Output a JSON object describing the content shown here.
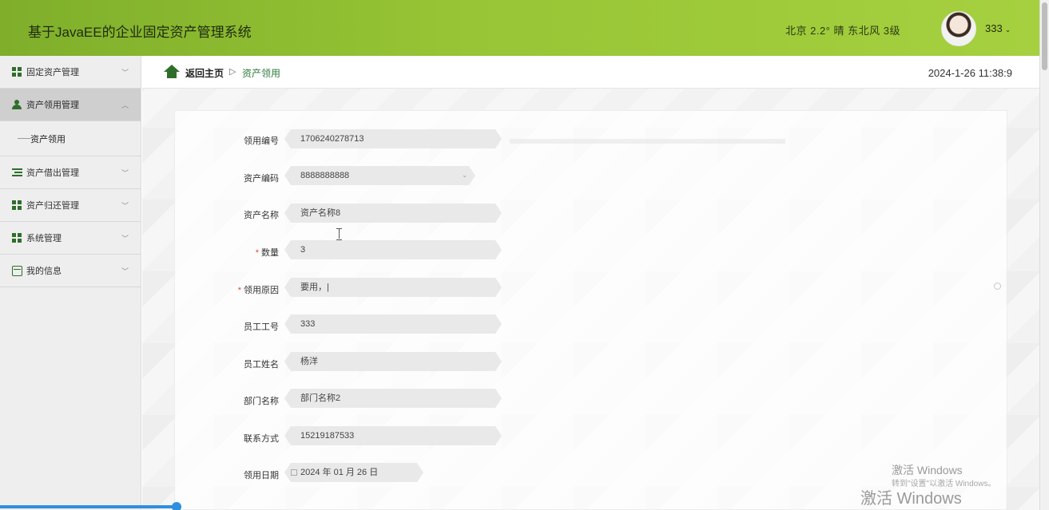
{
  "header": {
    "title": "基于JavaEE的企业固定资产管理系统",
    "weather": "北京  2.2°  晴  东北风  3级",
    "user": "333"
  },
  "sidebar": {
    "items": [
      {
        "label": "固定资产管理",
        "icon": "grid-icon"
      },
      {
        "label": "资产领用管理",
        "icon": "person-icon",
        "active": true
      },
      {
        "label": "资产借出管理",
        "icon": "list-icon"
      },
      {
        "label": "资产归还管理",
        "icon": "grid-icon"
      },
      {
        "label": "系统管理",
        "icon": "grid-icon"
      },
      {
        "label": "我的信息",
        "icon": "card-icon"
      }
    ],
    "sub_items": [
      {
        "label": "资产领用"
      }
    ]
  },
  "breadcrumb": {
    "home": "返回主页",
    "separator": "▷",
    "current": "资产领用"
  },
  "clock": "2024-1-26 11:38:9",
  "form": {
    "fields": [
      {
        "label": "领用编号",
        "value": "1706240278713",
        "required": false
      },
      {
        "label": "资产编码",
        "value": "8888888888",
        "required": false
      },
      {
        "label": "资产名称",
        "value": "资产名称8",
        "required": false
      },
      {
        "label": "数量",
        "value": "3",
        "required": true
      },
      {
        "label": "领用原因",
        "value": "要用，|",
        "required": true
      },
      {
        "label": "员工工号",
        "value": "333",
        "required": false
      },
      {
        "label": "员工姓名",
        "value": "杨洋",
        "required": false
      },
      {
        "label": "部门名称",
        "value": "部门名称2",
        "required": false
      },
      {
        "label": "联系方式",
        "value": "15219187533",
        "required": false
      },
      {
        "label": "领用日期",
        "value": "2024 年 01 月 26 日",
        "required": false
      }
    ]
  },
  "watermark": {
    "line1": "激活 Windows",
    "line2": "转到\"设置\"以激活 Windows。",
    "line3": "激活 Windows"
  },
  "colors": {
    "header_green": "#97c535",
    "icon_green": "#2e6e2a",
    "required_red": "#e0473a",
    "progress_blue": "#2f8ee0"
  }
}
